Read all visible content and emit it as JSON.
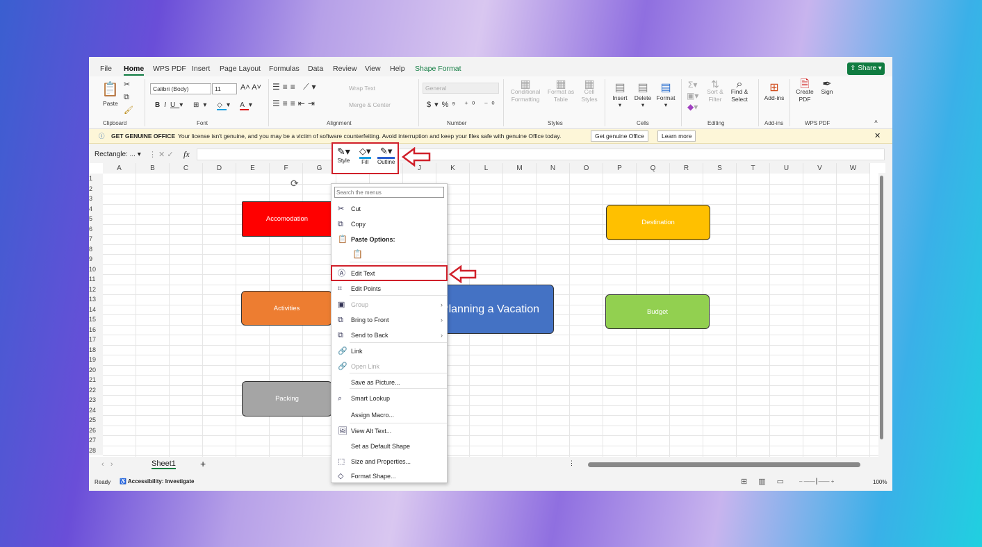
{
  "tabs": [
    "File",
    "Home",
    "WPS PDF",
    "Insert",
    "Page Layout",
    "Formulas",
    "Data",
    "Review",
    "View",
    "Help",
    "Shape Format"
  ],
  "share": "Share",
  "ribbon": {
    "paste": "Paste",
    "clipboard": "Clipboard",
    "font_name": "Calibri (Body)",
    "font_size": "11",
    "font": "Font",
    "wrap_text": "Wrap Text",
    "merge_center": "Merge & Center",
    "alignment": "Alignment",
    "number_format": "General",
    "number": "Number",
    "conditional": "Conditional Formatting",
    "format_table": "Format as Table",
    "cell_styles": "Cell Styles",
    "styles": "Styles",
    "insert": "Insert",
    "delete": "Delete",
    "format": "Format",
    "cells": "Cells",
    "sort_filter": "Sort & Filter",
    "find_select": "Find & Select",
    "editing": "Editing",
    "addins": "Add-ins",
    "addins_group": "Add-ins",
    "create_pdf": "Create PDF",
    "sign": "Sign",
    "wps_pdf": "WPS PDF"
  },
  "notification": {
    "title": "GET GENUINE OFFICE",
    "message": "Your license isn't genuine, and you may be a victim of software counterfeiting. Avoid interruption and keep your files safe with genuine Office today.",
    "btn1": "Get genuine Office",
    "btn2": "Learn more"
  },
  "formula_bar": {
    "name_box": "Rectangle: ...",
    "fx": "fx",
    "value": ""
  },
  "columns": [
    "A",
    "B",
    "C",
    "D",
    "E",
    "F",
    "G",
    "H",
    "I",
    "J",
    "K",
    "L",
    "M",
    "N",
    "O",
    "P",
    "Q",
    "R",
    "S",
    "T",
    "U",
    "V",
    "W"
  ],
  "rows": [
    "1",
    "2",
    "3",
    "4",
    "5",
    "6",
    "7",
    "8",
    "9",
    "10",
    "11",
    "12",
    "13",
    "14",
    "15",
    "16",
    "17",
    "18",
    "19",
    "20",
    "21",
    "22",
    "23",
    "24",
    "25",
    "26",
    "27",
    "28"
  ],
  "shapes": [
    {
      "label": "Accomodation",
      "color": "#ff0000"
    },
    {
      "label": "Destination",
      "color": "#ffc000"
    },
    {
      "label": "Activities",
      "color": "#ed7d31"
    },
    {
      "label": "Planning a Vacation",
      "color": "#4472c4"
    },
    {
      "label": "Budget",
      "color": "#92d050"
    },
    {
      "label": "Packing",
      "color": "#a5a5a5"
    }
  ],
  "mini_toolbar": {
    "style": "Style",
    "fill": "Fill",
    "outline": "Outline"
  },
  "context_menu": {
    "search_placeholder": "Search the menus",
    "items": [
      "Cut",
      "Copy",
      "Paste Options:",
      "Edit Text",
      "Edit Points",
      "Group",
      "Bring to Front",
      "Send to Back",
      "Link",
      "Open Link",
      "Save as Picture...",
      "Smart Lookup",
      "Assign Macro...",
      "View Alt Text...",
      "Set as Default Shape",
      "Size and Properties...",
      "Format Shape..."
    ]
  },
  "sheet_tab": "Sheet1",
  "status": {
    "ready": "Ready",
    "accessibility": "Accessibility: Investigate",
    "zoom": "100%"
  },
  "colors": {
    "accent": "#107c41",
    "highlight": "#d0202a"
  }
}
